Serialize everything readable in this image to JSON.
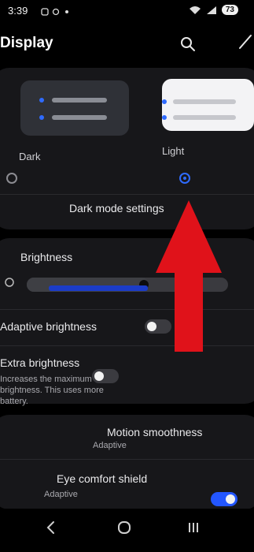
{
  "status_bar": {
    "time": "3:39",
    "battery": "73"
  },
  "header": {
    "title": "Display"
  },
  "theme": {
    "dark_label": "Dark",
    "light_label": "Light",
    "dark_mode_settings": "Dark mode settings",
    "selected": "Light"
  },
  "brightness": {
    "label": "Brightness",
    "level_percent": 45,
    "adaptive_label": "Adaptive brightness",
    "adaptive_on": false,
    "extra_label": "Extra brightness",
    "extra_desc": "Increases the maximum brightness. This uses more battery.",
    "extra_on": false
  },
  "motion": {
    "label": "Motion smoothness",
    "value": "Adaptive"
  },
  "eye": {
    "label": "Eye comfort shield",
    "value": "Adaptive",
    "on": true
  },
  "colors": {
    "accent": "#2f6bff",
    "card": "#17171a",
    "arrow": "#e0121a"
  }
}
